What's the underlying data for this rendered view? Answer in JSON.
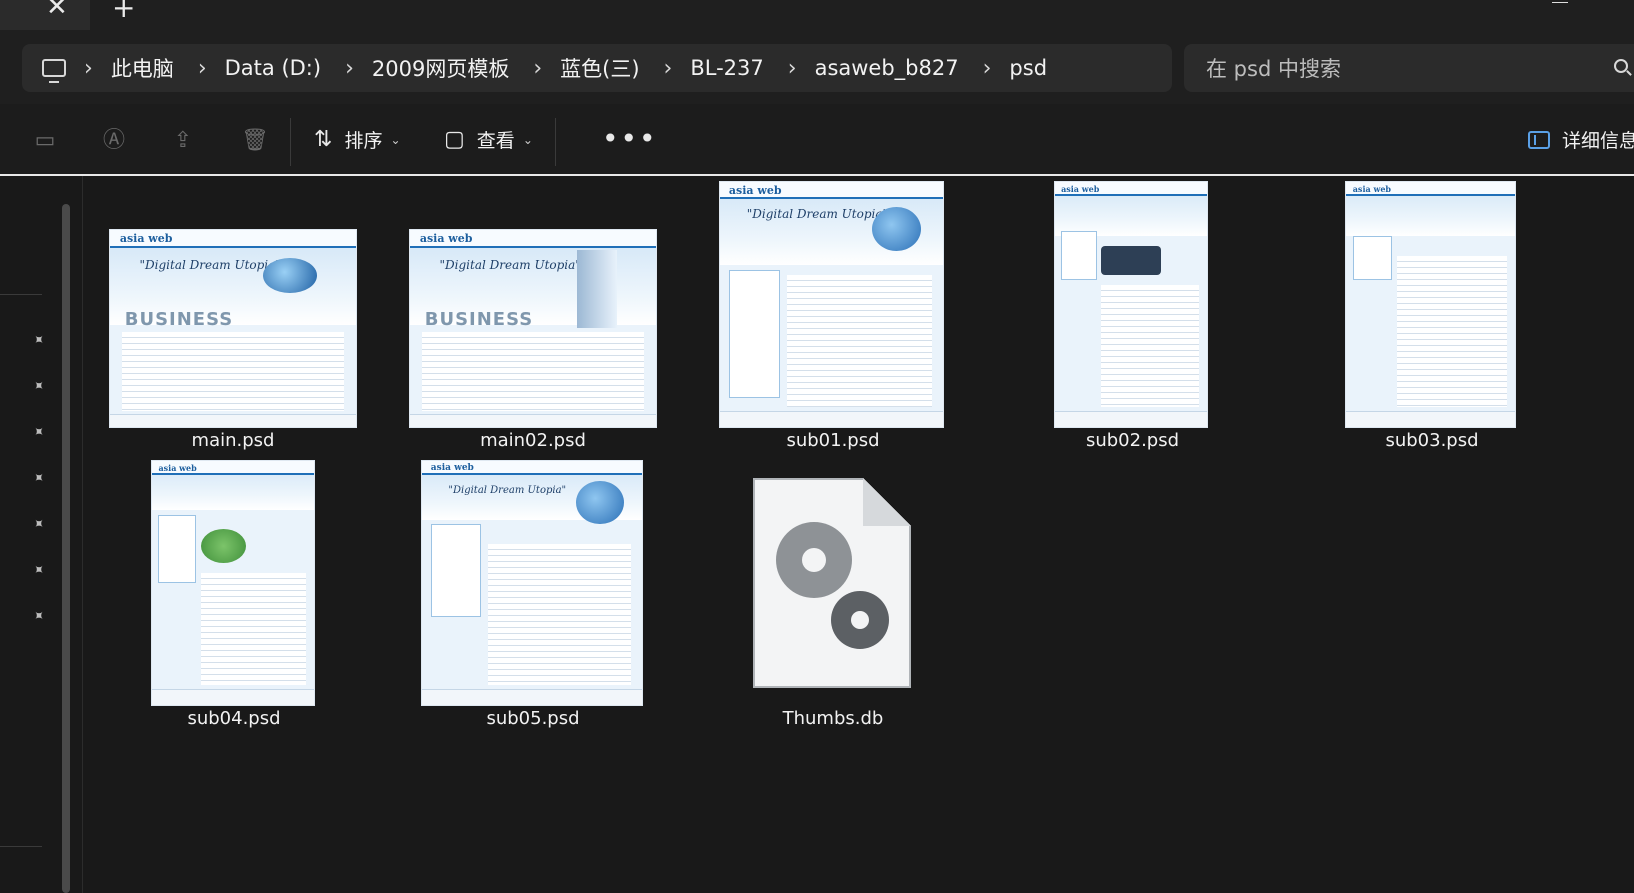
{
  "tabs": {
    "close_glyph": "✕",
    "new_glyph": "+"
  },
  "breadcrumb": [
    "此电脑",
    "Data (D:)",
    "2009网页模板",
    "蓝色(三)",
    "BL-237",
    "asaweb_b827",
    "psd"
  ],
  "search": {
    "placeholder": "在 psd 中搜索"
  },
  "toolbar": {
    "sort_label": "排序",
    "view_label": "查看",
    "more_label": "•••",
    "details_label": "详细信息"
  },
  "files": [
    {
      "name": "main.psd",
      "type": "psd-thumbnail"
    },
    {
      "name": "main02.psd",
      "type": "psd-thumbnail"
    },
    {
      "name": "sub01.psd",
      "type": "psd-thumbnail"
    },
    {
      "name": "sub02.psd",
      "type": "psd-thumbnail"
    },
    {
      "name": "sub03.psd",
      "type": "psd-thumbnail"
    },
    {
      "name": "sub04.psd",
      "type": "psd-thumbnail"
    },
    {
      "name": "sub05.psd",
      "type": "psd-thumbnail"
    },
    {
      "name": "Thumbs.db",
      "type": "system-file-icon"
    }
  ],
  "thumb_text": {
    "logo": "asia web",
    "tagline": "\"Digital Dream Utopia\"",
    "business": "BUSINESS"
  },
  "colors": {
    "accent": "#5aa0e6",
    "background": "#191919"
  }
}
